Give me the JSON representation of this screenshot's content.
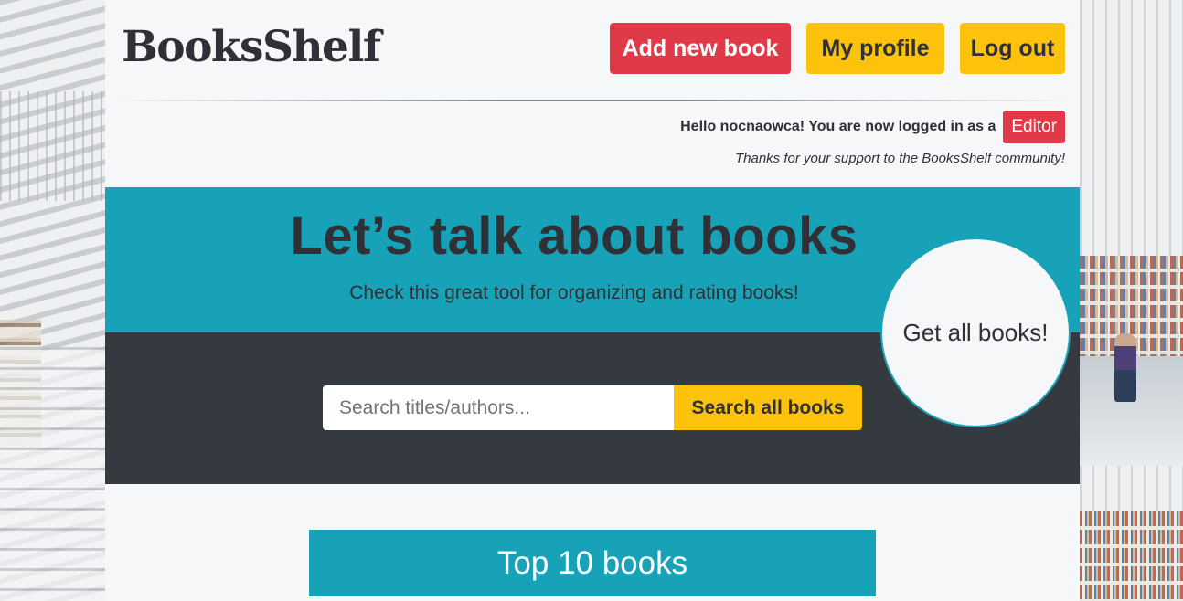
{
  "header": {
    "logo": "BooksShelf",
    "nav": {
      "add_book": "Add new book",
      "profile": "My profile",
      "logout": "Log out"
    }
  },
  "user": {
    "greeting": "Hello nocnaowca! You are now logged in as a",
    "role": "Editor",
    "thanks": "Thanks for your support to the BooksShelf community!"
  },
  "hero": {
    "title": "Let’s talk about books",
    "subtitle": "Check this great tool for organizing and rating books!",
    "cta": "Get all books!"
  },
  "search": {
    "placeholder": "Search titles/authors...",
    "value": "",
    "button": "Search all books"
  },
  "section": {
    "top_books": "Top 10 books"
  },
  "colors": {
    "teal": "#17a2b8",
    "dark": "#343a40",
    "red": "#e03a48",
    "yellow": "#fdc20c"
  }
}
